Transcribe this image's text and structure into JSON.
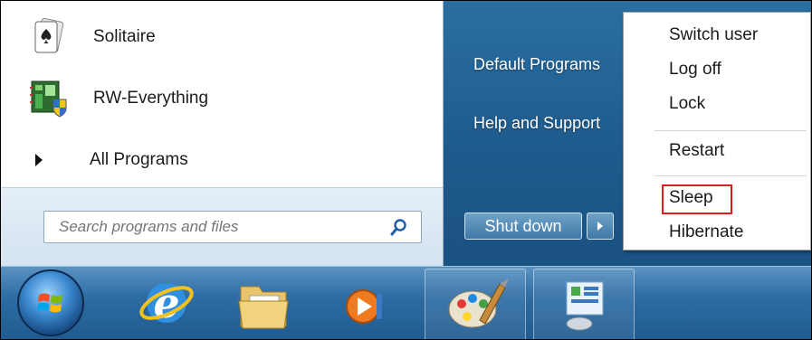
{
  "programs": {
    "items": [
      {
        "label": "Solitaire",
        "icon": "solitaire-icon"
      },
      {
        "label": "RW-Everything",
        "icon": "rw-everything-icon"
      }
    ],
    "all_programs_label": "All Programs"
  },
  "search": {
    "placeholder": "Search programs and files",
    "icon": "search-icon"
  },
  "right_pane": {
    "links": [
      "Default Programs",
      "Help and Support"
    ]
  },
  "shutdown": {
    "label": "Shut down",
    "icon": "chevron-right-icon"
  },
  "power_menu": {
    "items": [
      "Switch user",
      "Log off",
      "Lock",
      "Restart",
      "Sleep",
      "Hibernate"
    ],
    "highlighted": "Sleep",
    "highlight_color": "#e01b1b"
  },
  "taskbar": {
    "icons": [
      "start-orb-icon",
      "internet-explorer-icon",
      "windows-explorer-icon",
      "media-player-icon",
      "paint-icon",
      "control-panel-icon"
    ]
  }
}
